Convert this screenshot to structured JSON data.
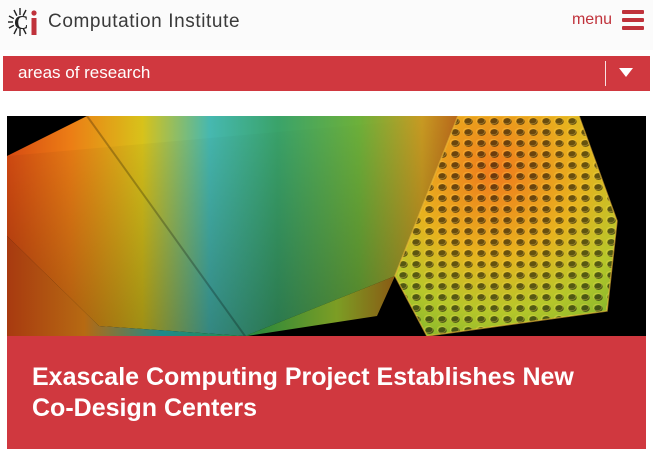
{
  "header": {
    "brand": "Computation Institute",
    "menu_label": "menu",
    "logo_icon": "ci-logo-icon",
    "menu_icon": "hamburger-menu-icon"
  },
  "areas_dropdown": {
    "label": "areas of research",
    "caret_icon": "chevron-down-icon"
  },
  "featured": {
    "title": "Exascale Computing Project Establishes New Co-Design Centers"
  },
  "colors": {
    "accent": "#d0383f",
    "brand_text": "#3a3a3a",
    "menu_accent": "#c0323b"
  }
}
